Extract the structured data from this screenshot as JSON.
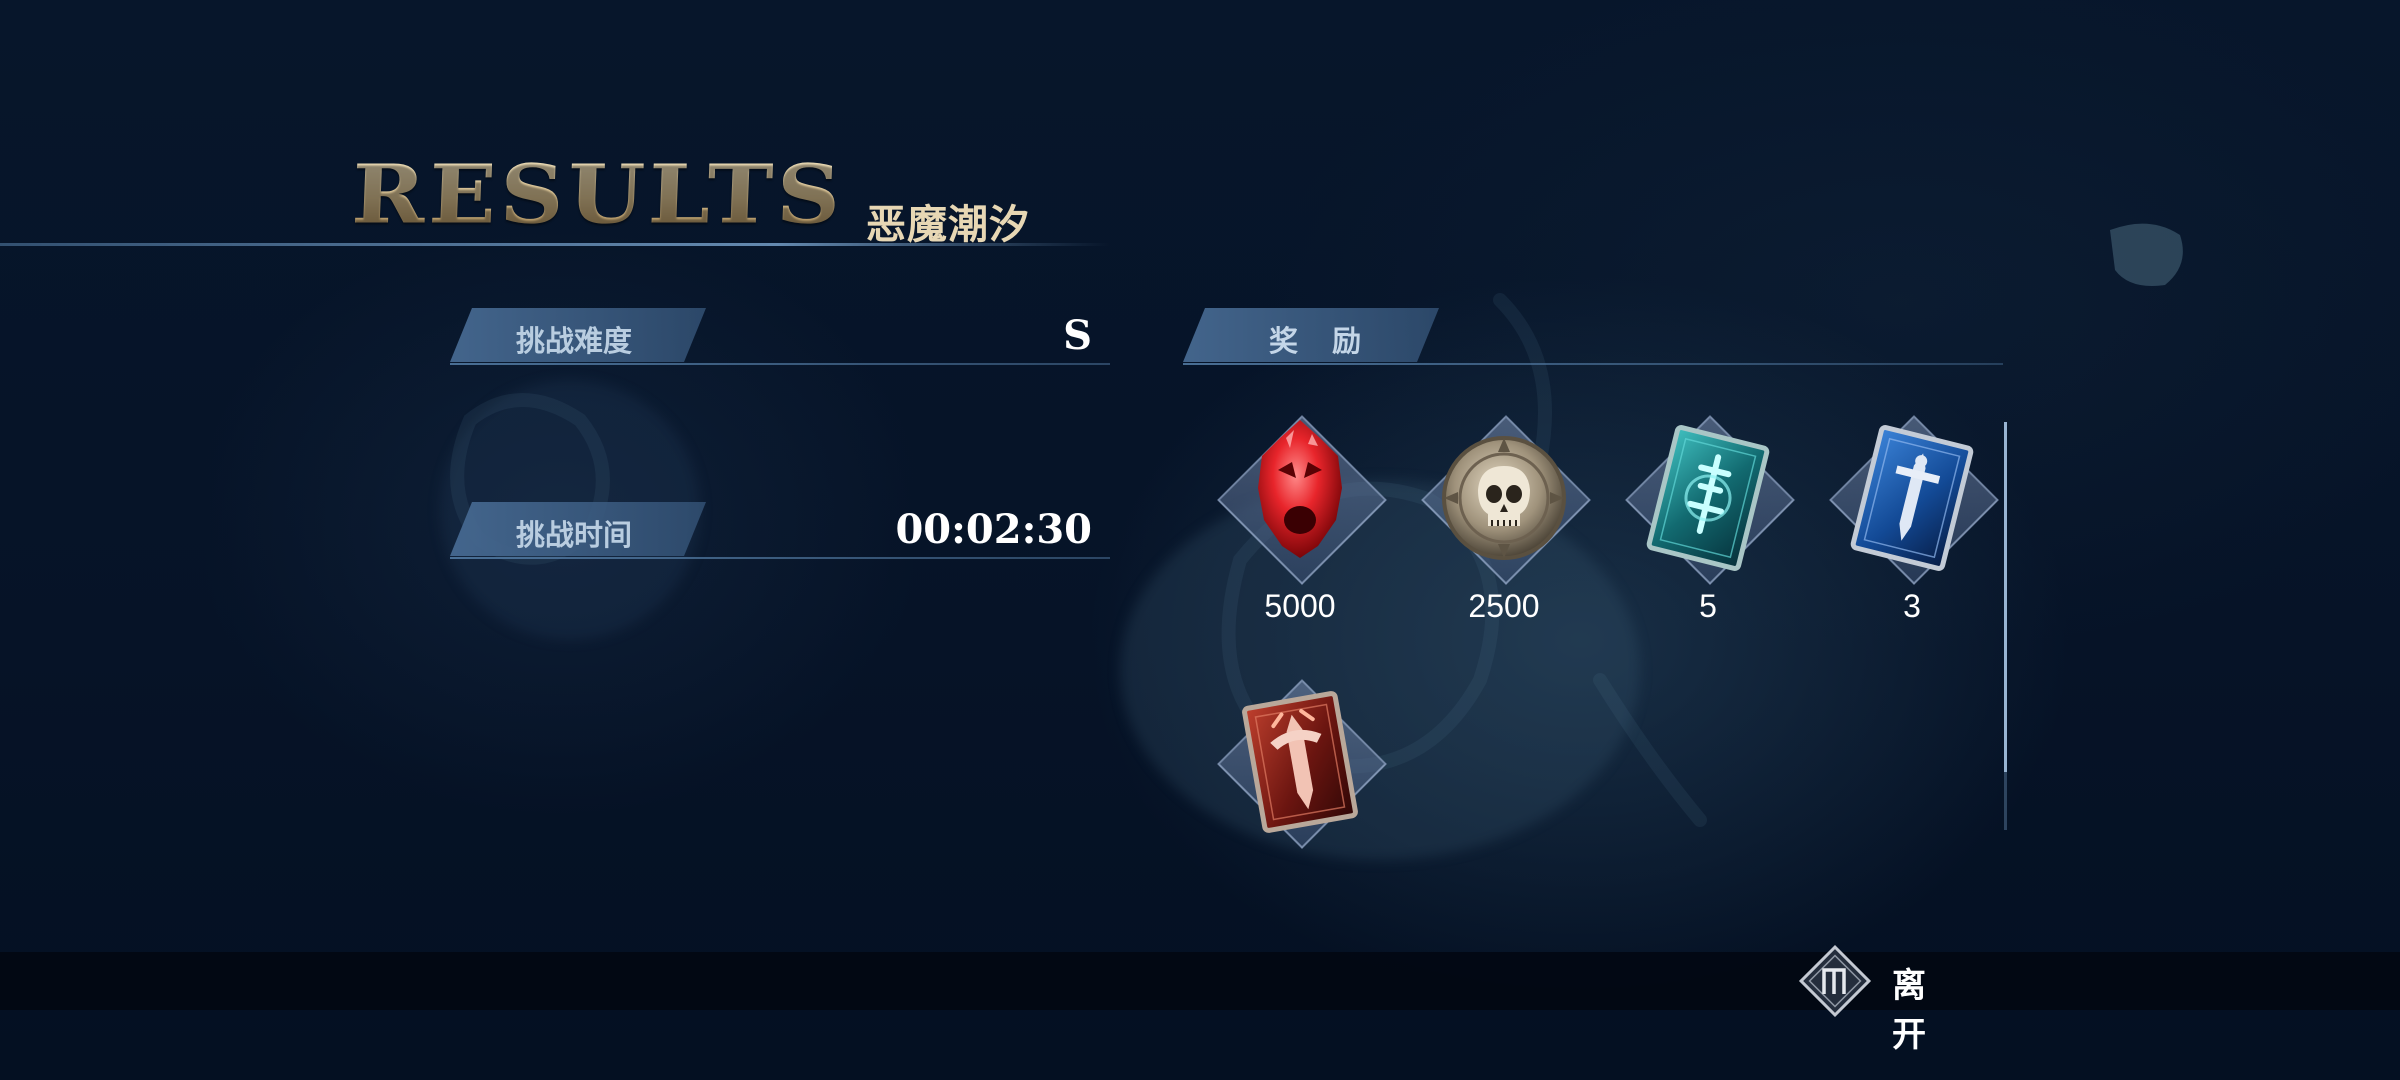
{
  "header": {
    "title": "RESULTS",
    "stage_name": "恶魔潮汐"
  },
  "stats": {
    "difficulty": {
      "label": "挑战难度",
      "value": "S"
    },
    "time": {
      "label": "挑战时间",
      "value": "00:02:30"
    }
  },
  "rewards": {
    "label": "奖 励",
    "items": [
      {
        "icon": "red-orb-icon",
        "count": "5000"
      },
      {
        "icon": "skull-medal-icon",
        "count": "2500"
      },
      {
        "icon": "cyan-card-icon",
        "count": "5"
      },
      {
        "icon": "blue-sword-card-icon",
        "count": "3"
      },
      {
        "icon": "red-sword-card-icon",
        "count": ""
      }
    ]
  },
  "footer": {
    "leave_label": "离 开",
    "leave_icon": "controller-button-icon"
  },
  "colors": {
    "background": "#061226",
    "title_gold": "#d9c7a0",
    "tag_blue": "#46698f",
    "text_white": "#ffffff"
  }
}
